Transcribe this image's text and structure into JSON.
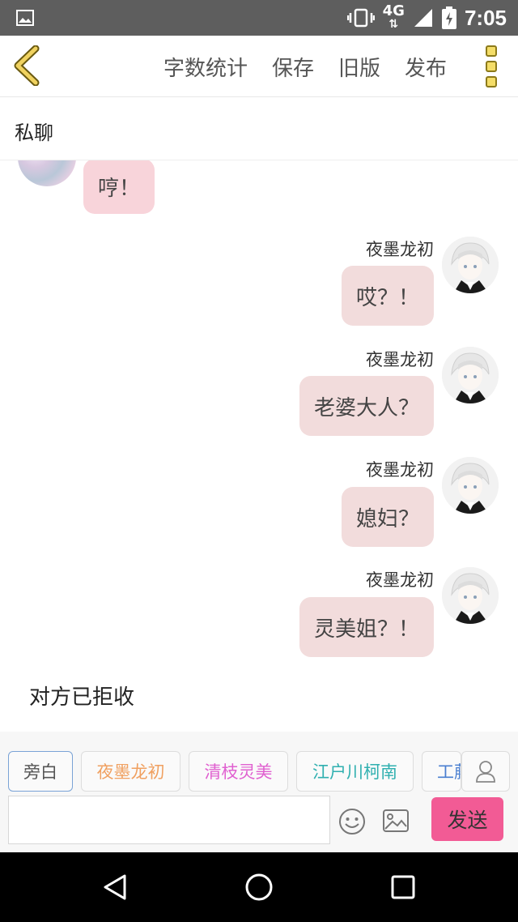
{
  "status_bar": {
    "network": "4G",
    "time": "7:05",
    "icons": [
      "gallery-icon",
      "vibrate-icon",
      "signal-icon",
      "battery-charging-icon"
    ]
  },
  "toolbar": {
    "back_icon": "chevron-left-icon",
    "word_count": "字数统计",
    "save": "保存",
    "old_version": "旧版",
    "publish": "发布",
    "more_icon": "menu-dots-icon"
  },
  "title": "私聊",
  "messages": [
    {
      "side": "left",
      "sender": "",
      "text": "哼！"
    },
    {
      "side": "right",
      "sender": "夜墨龙初",
      "text": "哎？！"
    },
    {
      "side": "right",
      "sender": "夜墨龙初",
      "text": "老婆大人？"
    },
    {
      "side": "right",
      "sender": "夜墨龙初",
      "text": "媳妇？"
    },
    {
      "side": "right",
      "sender": "夜墨龙初",
      "text": "灵美姐？！"
    }
  ],
  "system_message": "对方已拒收",
  "roles": [
    {
      "label": "旁白",
      "color": "#555555"
    },
    {
      "label": "夜墨龙初",
      "color": "#f0a060"
    },
    {
      "label": "清枝灵美",
      "color": "#e060d0"
    },
    {
      "label": "江户川柯南",
      "color": "#30b0b0"
    },
    {
      "label": "工藤",
      "color": "#4a7fd0"
    }
  ],
  "input": {
    "value": "",
    "send": "发送"
  },
  "colors": {
    "send_button": "#f25b95",
    "bubble_left": "#f8d4da",
    "bubble_right": "#f2dcdc"
  }
}
